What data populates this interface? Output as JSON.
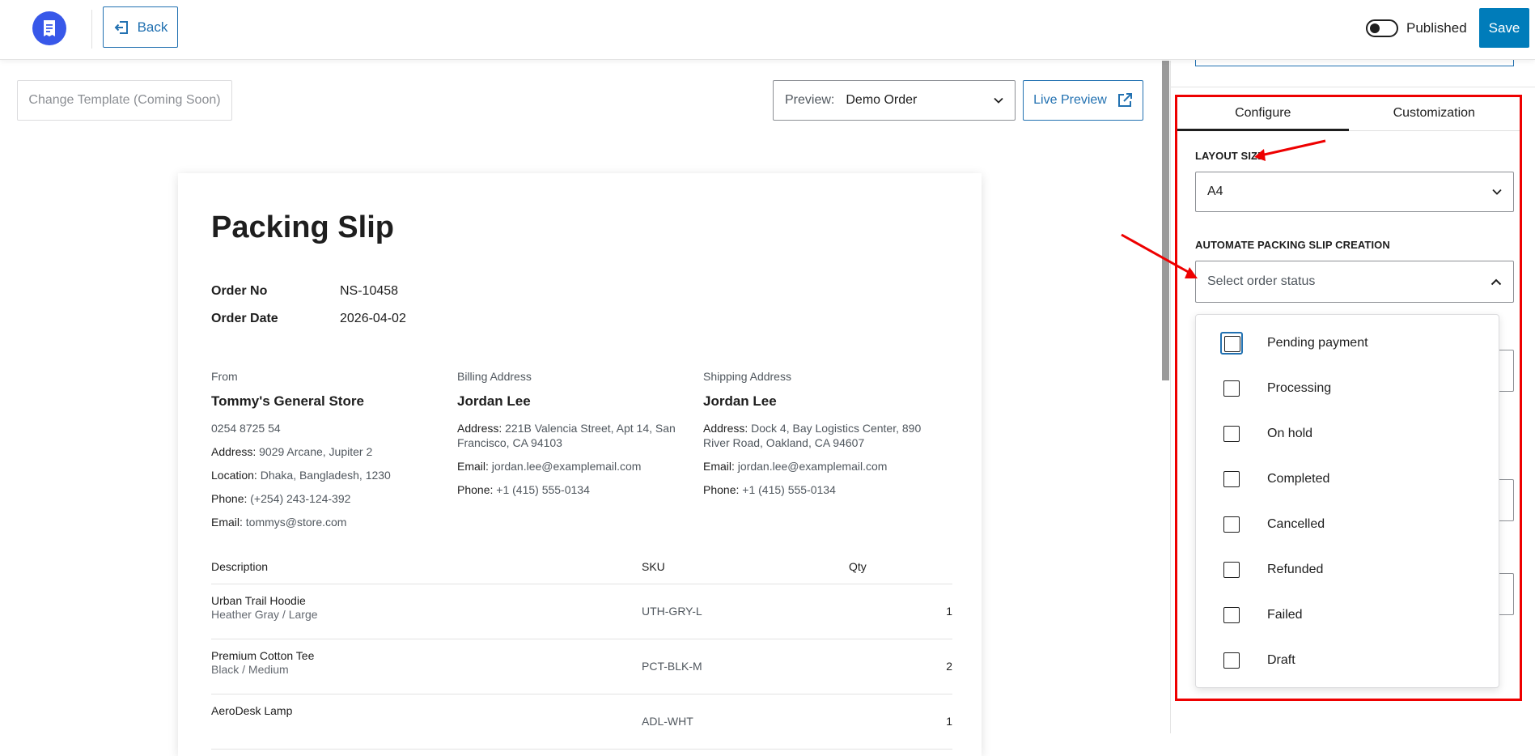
{
  "header": {
    "back_label": "Back",
    "published_label": "Published",
    "save_label": "Save"
  },
  "toolbar": {
    "change_template_label": "Change Template (Coming Soon)",
    "preview_label": "Preview:",
    "preview_value": "Demo Order",
    "live_preview_label": "Live Preview"
  },
  "document": {
    "title": "Packing Slip",
    "order_no_label": "Order No",
    "order_no": "NS-10458",
    "order_date_label": "Order Date",
    "order_date": "2026-04-02",
    "from": {
      "heading": "From",
      "name": "Tommy's General Store",
      "phone_line": "0254 8725 54",
      "address_label": "Address:",
      "address": "9029 Arcane, Jupiter 2",
      "location_label": "Location:",
      "location": "Dhaka, Bangladesh, 1230",
      "phone_label": "Phone:",
      "phone": "(+254) 243-124-392",
      "email_label": "Email:",
      "email": "tommys@store.com"
    },
    "billing": {
      "heading": "Billing Address",
      "name": "Jordan Lee",
      "address_label": "Address:",
      "address": "221B Valencia Street, Apt 14, San Francisco, CA 94103",
      "email_label": "Email:",
      "email": "jordan.lee@examplemail.com",
      "phone_label": "Phone:",
      "phone": "+1 (415) 555-0134"
    },
    "shipping": {
      "heading": "Shipping Address",
      "name": "Jordan Lee",
      "address_label": "Address:",
      "address": "Dock 4, Bay Logistics Center, 890 River Road, Oakland, CA 94607",
      "email_label": "Email:",
      "email": "jordan.lee@examplemail.com",
      "phone_label": "Phone:",
      "phone": "+1 (415) 555-0134"
    },
    "table_headers": [
      "Description",
      "SKU",
      "Qty"
    ],
    "items": [
      {
        "name": "Urban Trail Hoodie",
        "variant": "Heather Gray / Large",
        "sku": "UTH-GRY-L",
        "qty": "1"
      },
      {
        "name": "Premium Cotton Tee",
        "variant": "Black / Medium",
        "sku": "PCT-BLK-M",
        "qty": "2"
      },
      {
        "name": "AeroDesk Lamp",
        "variant": "",
        "sku": "ADL-WHT",
        "qty": "1"
      }
    ]
  },
  "sidebar": {
    "tabs": [
      "Configure",
      "Customization"
    ],
    "layout_size_label": "LAYOUT SIZE",
    "layout_size_value": "A4",
    "automate_label": "AUTOMATE PACKING SLIP CREATION",
    "order_status_placeholder": "Select order status",
    "order_status_options": [
      "Pending payment",
      "Processing",
      "On hold",
      "Completed",
      "Cancelled",
      "Refunded",
      "Failed",
      "Draft"
    ]
  },
  "colors": {
    "accent": "#2271b1",
    "save_button": "#007cba",
    "logo": "#3858e9",
    "annotation": "#e00000"
  }
}
